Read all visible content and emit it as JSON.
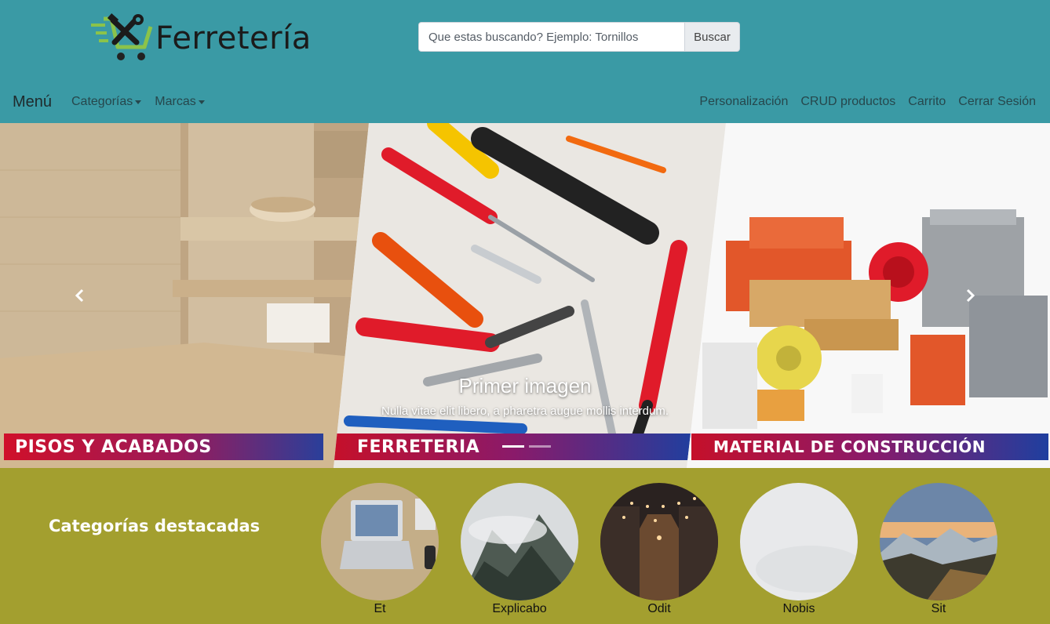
{
  "header": {
    "logo_text": "Ferretería",
    "search": {
      "placeholder": "Que estas buscando? Ejemplo: Tornillos",
      "button_label": "Buscar"
    }
  },
  "nav": {
    "brand": "Menú",
    "left": [
      {
        "label": "Categorías"
      },
      {
        "label": "Marcas"
      }
    ],
    "right": [
      {
        "label": "Personalización"
      },
      {
        "label": "CRUD productos"
      },
      {
        "label": "Carrito"
      },
      {
        "label": "Cerrar Sesión"
      }
    ]
  },
  "carousel": {
    "panels": [
      {
        "banner": "PISOS Y ACABADOS"
      },
      {
        "banner": "FERRETERIA"
      },
      {
        "banner": "MATERIAL DE CONSTRUCCIÓN"
      }
    ],
    "caption_title": "Primer imagen",
    "caption_text": "Nulla vitae elit libero, a pharetra augue mollis interdum.",
    "active_index": 0
  },
  "featured": {
    "title": "Categorías destacadas",
    "categories": [
      {
        "label": "Et",
        "icon": "laptop-photo"
      },
      {
        "label": "Explicabo",
        "icon": "misty-forest-photo"
      },
      {
        "label": "Odit",
        "icon": "night-street-lights-photo"
      },
      {
        "label": "Nobis",
        "icon": "white-blank-photo"
      },
      {
        "label": "Sit",
        "icon": "mountain-landscape-photo"
      }
    ]
  },
  "colors": {
    "header_bg": "#3a9aa5",
    "featured_bg": "#a39f2f",
    "banner_red": "#c5102a",
    "banner_blue": "#1f3f9f"
  }
}
